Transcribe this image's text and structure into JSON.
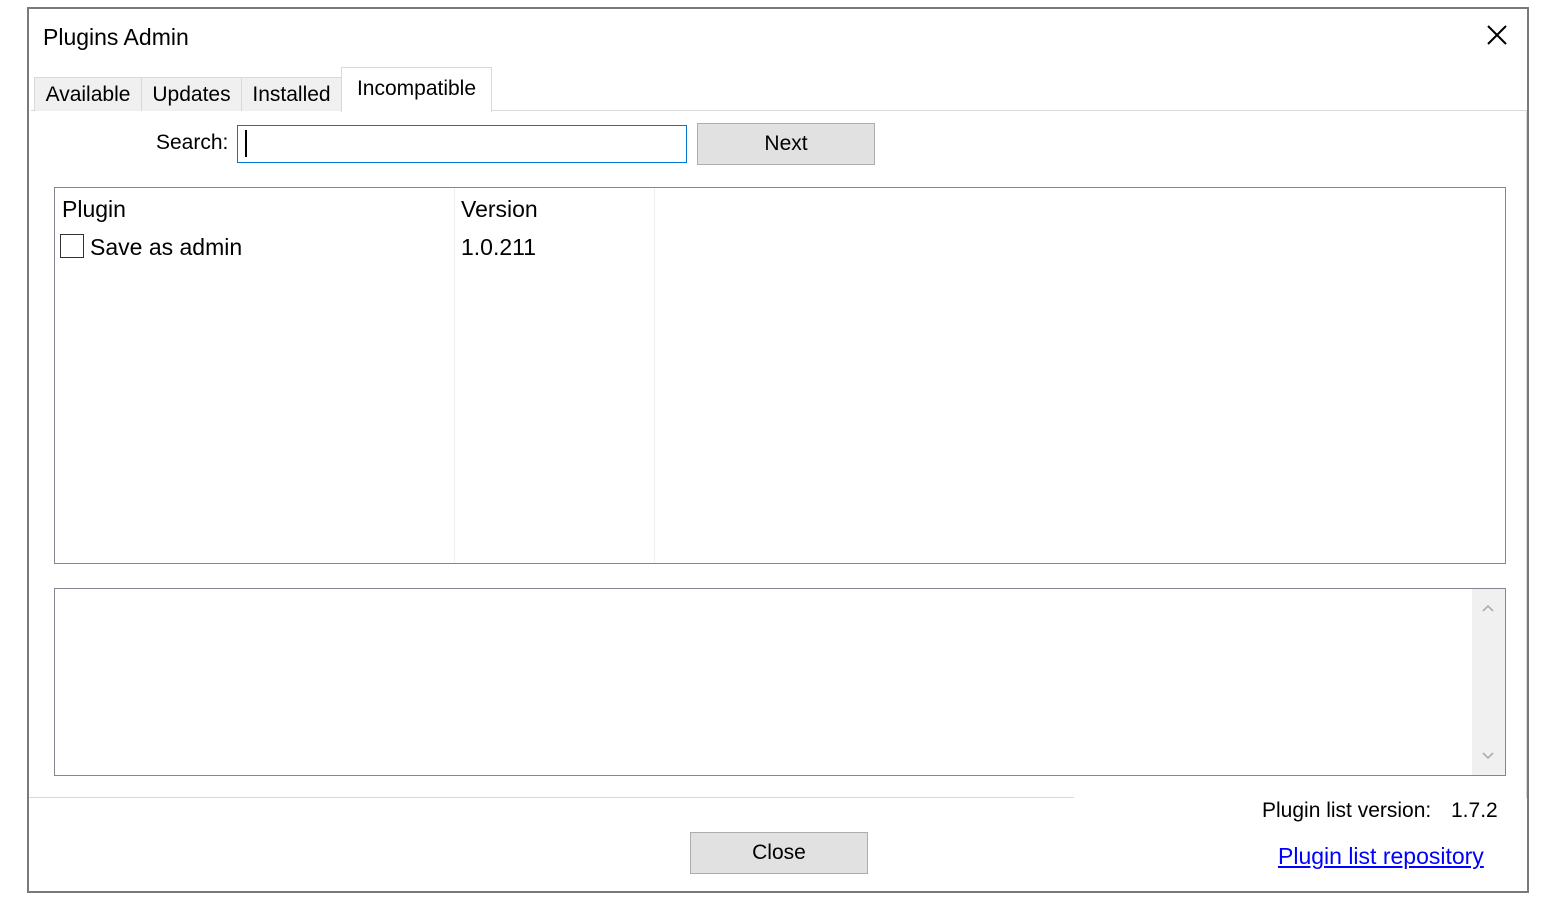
{
  "window": {
    "title": "Plugins Admin"
  },
  "tabs": [
    {
      "label": "Available"
    },
    {
      "label": "Updates"
    },
    {
      "label": "Installed"
    },
    {
      "label": "Incompatible"
    }
  ],
  "search": {
    "label": "Search:",
    "value": ""
  },
  "buttons": {
    "next": "Next",
    "close": "Close"
  },
  "list": {
    "columns": [
      "Plugin",
      "Version"
    ],
    "rows": [
      {
        "name": "Save as admin",
        "version": "1.0.211",
        "checked": false
      }
    ]
  },
  "description": {
    "text": ""
  },
  "footer": {
    "plugin_list_version_label": "Plugin list version:",
    "plugin_list_version_value": "1.7.2",
    "repo_link": "Plugin list repository"
  },
  "icons": {
    "close": "close-icon",
    "scroll_up": "chevron-up-icon",
    "scroll_down": "chevron-down-icon"
  }
}
